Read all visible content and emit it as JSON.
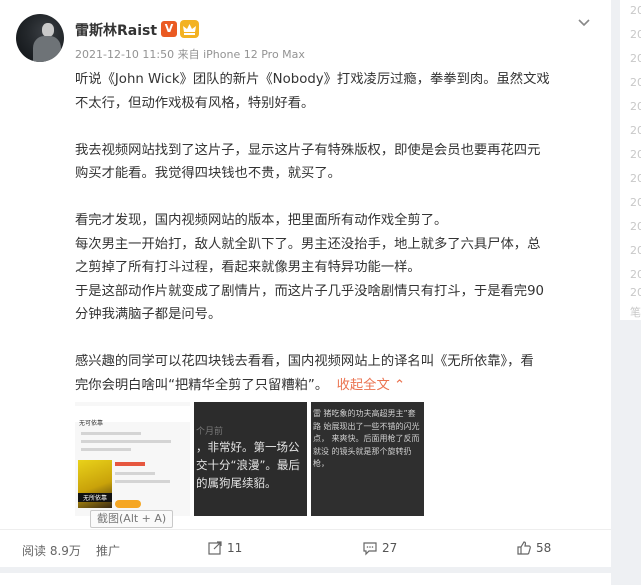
{
  "post": {
    "author": "雷斯林Raist",
    "badge_v": "V",
    "meta": "2021-12-10 11:50 来自 iPhone 12 Pro Max",
    "paragraphs": [
      [
        "听说《John Wick》团队的新片《Nobody》打戏凌厉过瘾，拳拳到肉。虽然文戏",
        "不太行，但动作戏极有风格，特别好看。"
      ],
      [
        "我去视频网站找到了这片子，显示这片子有特殊版权，即使是会员也要再花四元",
        "购买才能看。我觉得四块钱也不贵，就买了。"
      ],
      [
        "看完才发现，国内视频网站的版本，把里面所有动作戏全剪了。",
        "每次男主一开始打，敌人就全趴下了。男主还没抬手，地上就多了六具尸体，总",
        "之剪掉了所有打斗过程，看起来就像男主有特异功能一样。",
        "于是这部动作片就变成了剧情片，而这片子几乎没啥剧情只有打斗，于是看完90",
        "分钟我满脑子都是问号。"
      ],
      [
        "感兴趣的同学可以花四块钱去看看，国内视频网站上的译名叫《无所依靠》，看"
      ]
    ],
    "last_line": "完你会明白啥叫“把精华全剪了只留糟粕”。",
    "collapse_label": "收起全文",
    "collapse_arrow": "⌃"
  },
  "images": {
    "thumb1_title": "无可依靠",
    "thumb1_poster_label": "无所依靠",
    "thumb2_faint": "个月前",
    "thumb2_text": "，非常好。第一场公交十分“浪漫”。最后的属狗尾续貂。",
    "thumb3_text": "雷 猪吃象的功夫高超男主”套路 始展现出了一些不错的闪光点， 来爽快。后面用枪了反而就没 的镜头就是那个旋转扔枪，"
  },
  "tooltip": "截图(Alt + A)",
  "actions": {
    "reads": "阅读 8.9万",
    "promote": "推广",
    "reposts": "11",
    "comments": "27",
    "likes": "58"
  },
  "sidebar": [
    "20",
    "20",
    "20",
    "20",
    "20",
    "20",
    "20",
    "20",
    "20",
    "20",
    "20",
    "20",
    "20",
    "笔"
  ],
  "colors": {
    "accent": "#eb7350",
    "v_badge": "#ea5a22",
    "crown_badge": "#f3b222"
  },
  "icons": [
    "chevron-down-icon",
    "repost-icon",
    "comment-icon",
    "like-icon",
    "crown-icon"
  ]
}
